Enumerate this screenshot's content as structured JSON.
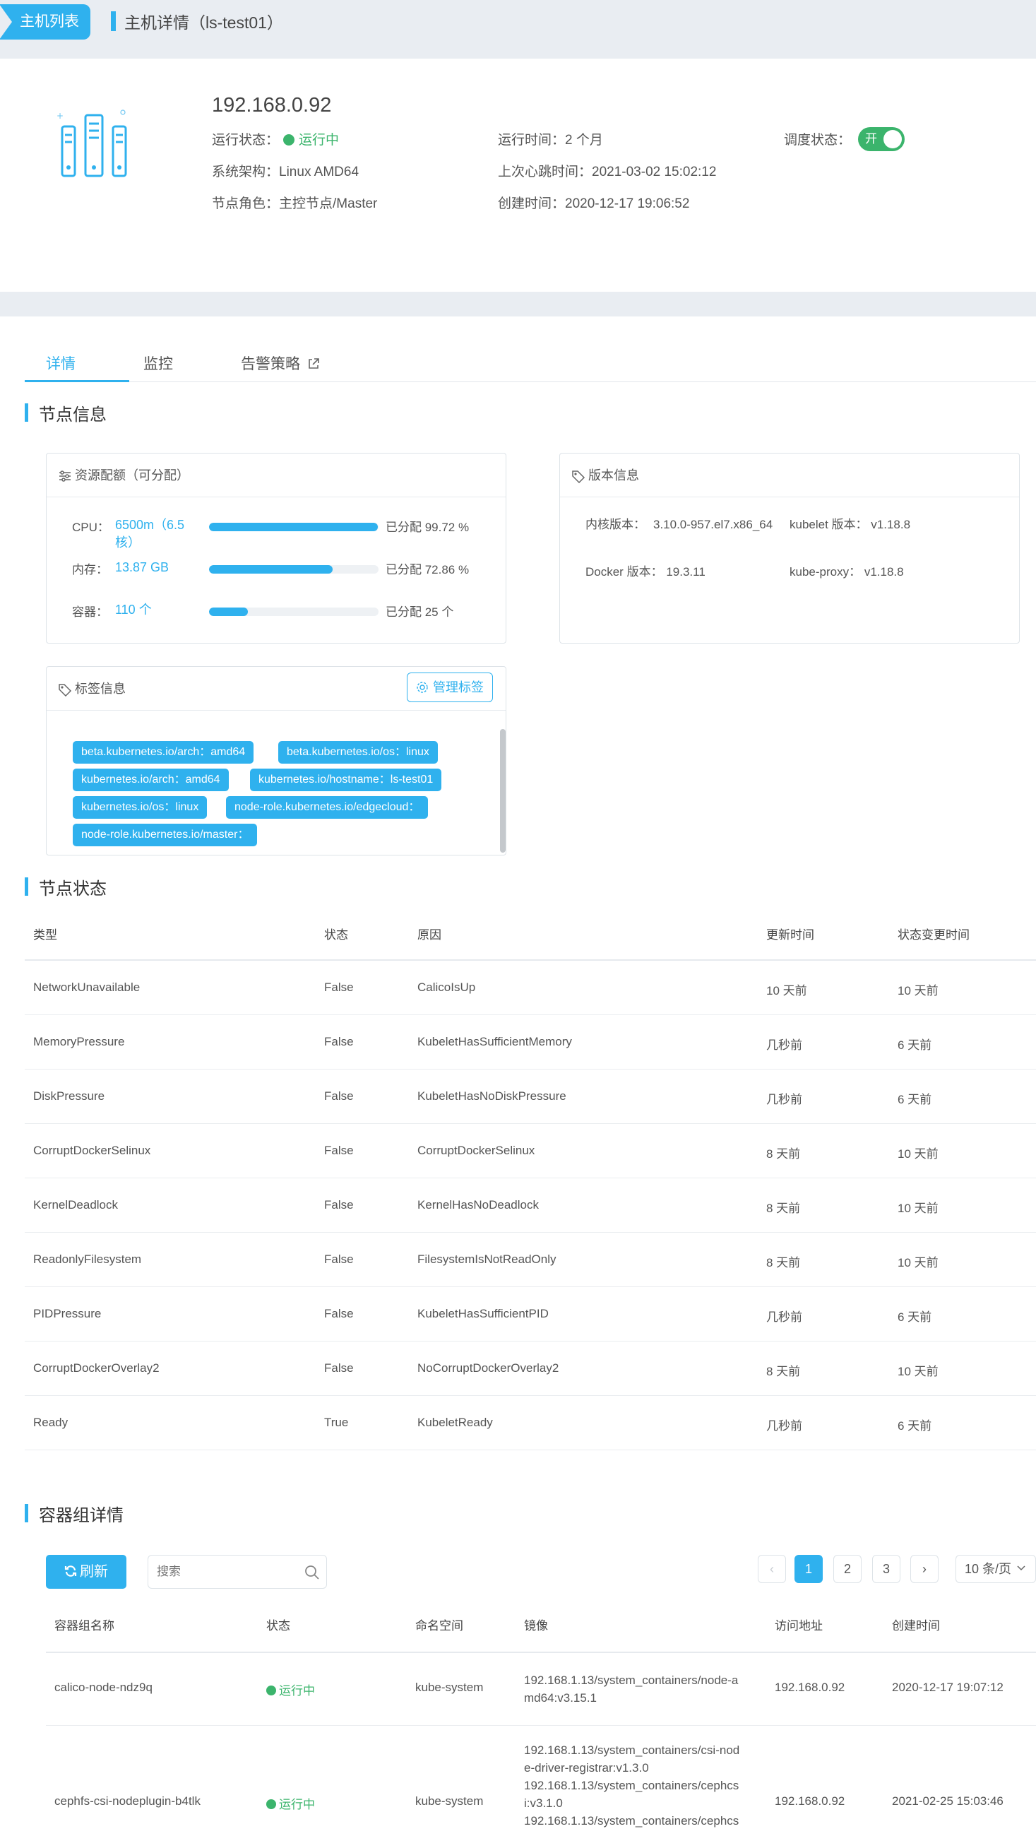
{
  "header": {
    "back_label": "主机列表",
    "title": "主机详情（ls-test01）"
  },
  "host": {
    "ip": "192.168.0.92",
    "run_status_label": "运行状态：",
    "run_status_value": "运行中",
    "uptime_label": "运行时间：",
    "uptime_value": "2 个月",
    "schedule_label": "调度状态：",
    "schedule_value": "开",
    "arch_label": "系统架构：",
    "arch_value": "Linux AMD64",
    "heartbeat_label": "上次心跳时间：",
    "heartbeat_value": "2021-03-02 15:02:12",
    "role_label": "节点角色：",
    "role_value": "主控节点/Master",
    "created_label": "创建时间：",
    "created_value": "2020-12-17 19:06:52"
  },
  "tabs": [
    {
      "label": "详情"
    },
    {
      "label": "监控"
    },
    {
      "label": "告警策略"
    }
  ],
  "node_info": {
    "title": "节点信息",
    "resource": {
      "title": "资源配额（可分配）",
      "rows": [
        {
          "label": "CPU：",
          "value": "6500m（6.5核）",
          "allocated": "已分配 99.72 %",
          "fill": 0.9972
        },
        {
          "label": "内存：",
          "value": "13.87 GB",
          "allocated": "已分配 72.86 %",
          "fill": 0.7286
        },
        {
          "label": "容器：",
          "value": "110 个",
          "allocated": "已分配 25 个",
          "fill": 0.2273
        }
      ]
    },
    "version": {
      "title": "版本信息",
      "kernel_label": "内核版本：",
      "kernel_value": "3.10.0-957.el7.x86_64",
      "kubelet_label": "kubelet 版本：",
      "kubelet_value": "v1.18.8",
      "docker_label": "Docker 版本：",
      "docker_value": "19.3.11",
      "proxy_label": "kube-proxy：",
      "proxy_value": "v1.18.8"
    },
    "labels": {
      "title": "标签信息",
      "manage_label": "管理标签",
      "tags": [
        "beta.kubernetes.io/arch：amd64",
        "beta.kubernetes.io/os：linux",
        "kubernetes.io/arch：amd64",
        "kubernetes.io/hostname：ls-test01",
        "kubernetes.io/os：linux",
        "node-role.kubernetes.io/edgecloud：",
        "node-role.kubernetes.io/master："
      ]
    }
  },
  "node_status": {
    "title": "节点状态",
    "columns": [
      "类型",
      "状态",
      "原因",
      "更新时间",
      "状态变更时间"
    ],
    "rows": [
      [
        "NetworkUnavailable",
        "False",
        "CalicoIsUp",
        "10 天前",
        "10 天前"
      ],
      [
        "MemoryPressure",
        "False",
        "KubeletHasSufficientMemory",
        "几秒前",
        "6 天前"
      ],
      [
        "DiskPressure",
        "False",
        "KubeletHasNoDiskPressure",
        "几秒前",
        "6 天前"
      ],
      [
        "CorruptDockerSelinux",
        "False",
        "CorruptDockerSelinux",
        "8 天前",
        "10 天前"
      ],
      [
        "KernelDeadlock",
        "False",
        "KernelHasNoDeadlock",
        "8 天前",
        "10 天前"
      ],
      [
        "ReadonlyFilesystem",
        "False",
        "FilesystemIsNotReadOnly",
        "8 天前",
        "10 天前"
      ],
      [
        "PIDPressure",
        "False",
        "KubeletHasSufficientPID",
        "几秒前",
        "6 天前"
      ],
      [
        "CorruptDockerOverlay2",
        "False",
        "NoCorruptDockerOverlay2",
        "8 天前",
        "10 天前"
      ],
      [
        "Ready",
        "True",
        "KubeletReady",
        "几秒前",
        "6 天前"
      ]
    ]
  },
  "pods": {
    "title": "容器组详情",
    "refresh_label": "刷新",
    "search_placeholder": "搜索",
    "pages": [
      "1",
      "2",
      "3"
    ],
    "prev": "‹",
    "next": "›",
    "per_page": "10 条/页",
    "columns": [
      "容器组名称",
      "状态",
      "命名空间",
      "镜像",
      "访问地址",
      "创建时间"
    ],
    "rows": [
      {
        "name": "calico-node-ndz9q",
        "status": "运行中",
        "namespace": "kube-system",
        "image": [
          "192.168.1.13/system_containers/node-a",
          "md64:v3.15.1"
        ],
        "address": "192.168.0.92",
        "created": "2020-12-17 19:07:12"
      },
      {
        "name": "cephfs-csi-nodeplugin-b4tlk",
        "status": "运行中",
        "namespace": "kube-system",
        "image": [
          "192.168.1.13/system_containers/csi-nod",
          "e-driver-registrar:v1.3.0",
          "192.168.1.13/system_containers/cephcs",
          "i:v3.1.0",
          "192.168.1.13/system_containers/cephcs"
        ],
        "address": "192.168.0.92",
        "created": "2021-02-25 15:03:46"
      }
    ]
  },
  "colors": {
    "accent": "#2fb1ee",
    "success": "#3bb46c",
    "header_bg": "#e9edf2"
  }
}
